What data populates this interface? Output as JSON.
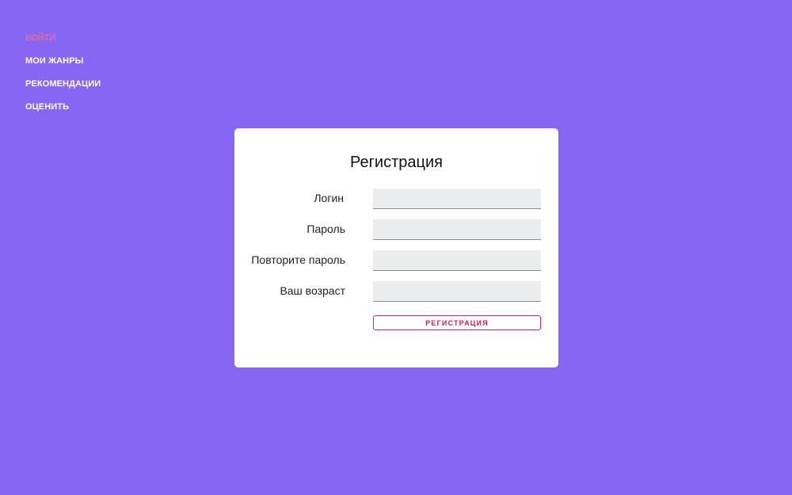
{
  "nav": {
    "items": [
      {
        "label": "ВОЙТИ",
        "active": true
      },
      {
        "label": "МОИ ЖАНРЫ",
        "active": false
      },
      {
        "label": "РЕКОМЕНДАЦИИ",
        "active": false
      },
      {
        "label": "ОЦЕНИТЬ",
        "active": false
      }
    ]
  },
  "form": {
    "title": "Регистрация",
    "fields": [
      {
        "label": "Логин",
        "value": ""
      },
      {
        "label": "Пароль",
        "value": ""
      },
      {
        "label": "Повторите пароль",
        "value": ""
      },
      {
        "label": "Ваш возраст",
        "value": ""
      }
    ],
    "submit_label": "РЕГИСТРАЦИЯ"
  },
  "colors": {
    "background": "#8866f4",
    "nav_active": "#ff6f87",
    "accent": "#e91e63",
    "card": "#ffffff",
    "input_bg": "#eaecee"
  }
}
